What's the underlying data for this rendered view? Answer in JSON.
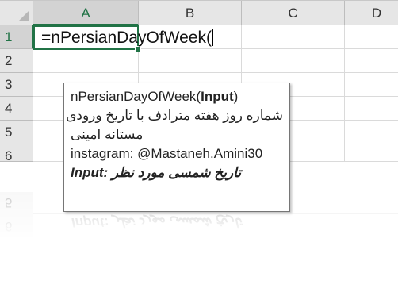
{
  "columns": [
    "A",
    "B",
    "C",
    "D"
  ],
  "rows": [
    "1",
    "2",
    "3",
    "4",
    "5",
    "6"
  ],
  "active_cell": {
    "column": "A",
    "row": "1",
    "formula": "=nPersianDayOfWeek("
  },
  "tooltip": {
    "signature_fn": "nPersianDayOfWeek(",
    "signature_arg": "Input",
    "signature_close": ")",
    "description_line1": "شماره روز هفته مترادف با تاریخ ورودی",
    "description_line2": "مستانه امینی",
    "instagram": "instagram: @Mastaneh.Amini30",
    "arg_help": "Input: تاریخ شمسی مورد نظر"
  },
  "colors": {
    "accent": "#217346",
    "header_bg": "#e6e6e6"
  }
}
